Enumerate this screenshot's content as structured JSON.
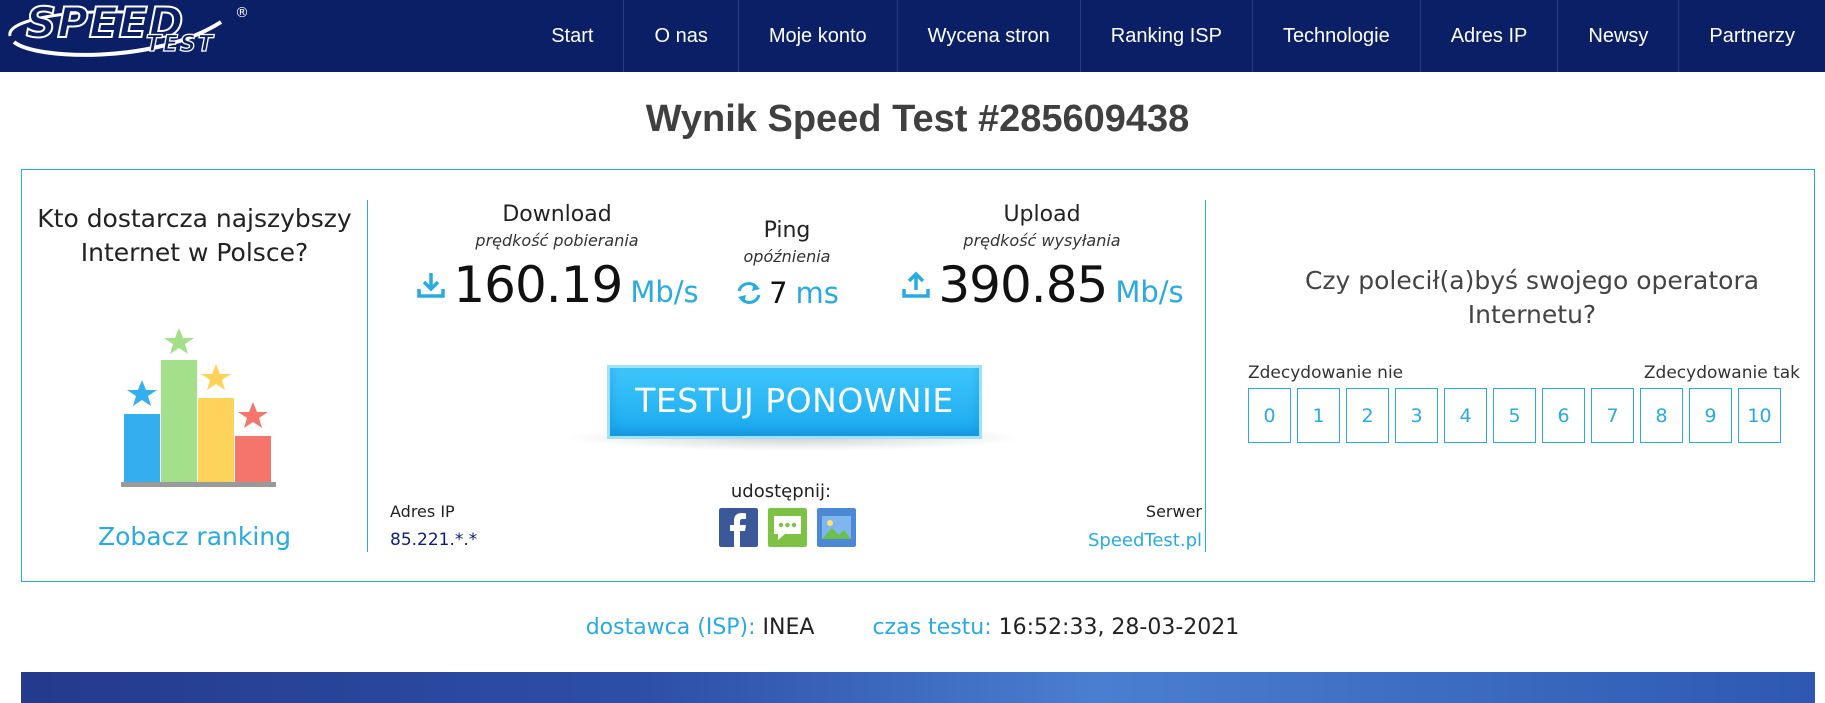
{
  "logo": {
    "name": "SPEED",
    "sub": "TEST",
    "reg": "®"
  },
  "nav": {
    "items": [
      "Start",
      "O nas",
      "Moje konto",
      "Wycena stron",
      "Ranking ISP",
      "Technologie",
      "Adres IP",
      "Newsy",
      "Partnerzy"
    ]
  },
  "page_title": "Wynik Speed Test #285609438",
  "ranking": {
    "question": "Kto dostarcza najszybszy Internet w Polsce?",
    "link": "Zobacz ranking"
  },
  "download": {
    "title": "Download",
    "subtitle": "prędkość pobierania",
    "value": "160.19",
    "unit": "Mb/s",
    "icon": "download-icon"
  },
  "ping": {
    "title": "Ping",
    "subtitle": "opóźnienia",
    "value": "7",
    "unit": "ms",
    "icon": "refresh-icon"
  },
  "upload": {
    "title": "Upload",
    "subtitle": "prędkość wysyłania",
    "value": "390.85",
    "unit": "Mb/s",
    "icon": "upload-icon"
  },
  "retest_button": "TESTUJ PONOWNIE",
  "ip": {
    "label": "Adres IP",
    "value": "85.221.*.*"
  },
  "share": {
    "label": "udostępnij:",
    "icons": [
      "facebook-icon",
      "comment-icon",
      "image-icon"
    ]
  },
  "server": {
    "label": "Serwer",
    "value": "SpeedTest.pl"
  },
  "recommend": {
    "question": "Czy polecił(a)byś swojego operatora Internetu?",
    "low_label": "Zdecydowanie nie",
    "high_label": "Zdecydowanie tak",
    "options": [
      "0",
      "1",
      "2",
      "3",
      "4",
      "5",
      "6",
      "7",
      "8",
      "9",
      "10"
    ]
  },
  "info": {
    "isp_label": "dostawca (ISP):",
    "isp_value": "INEA",
    "time_label": "czas testu:",
    "time_value": "16:52:33, 28-03-2021"
  },
  "colors": {
    "nav_bg": "#0b1f66",
    "accent": "#29aae1",
    "button": "#1aa9ef"
  }
}
